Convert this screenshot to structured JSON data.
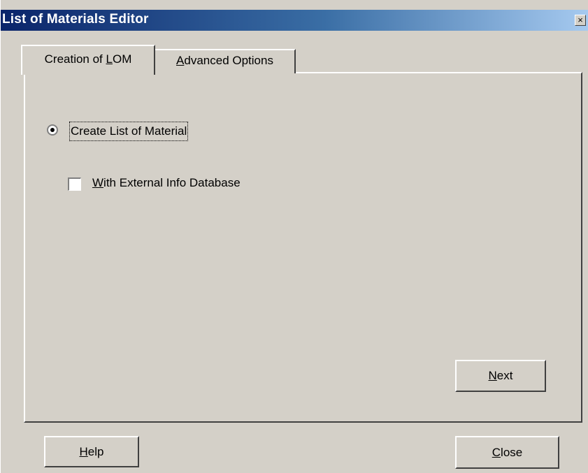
{
  "window": {
    "title": "List of Materials Editor",
    "close_glyph": "×"
  },
  "tabs": [
    {
      "pre": "Creation of ",
      "mnemonic": "L",
      "post": "OM",
      "selected": true
    },
    {
      "pre": "",
      "mnemonic": "A",
      "post": "dvanced Options",
      "selected": false
    }
  ],
  "options": {
    "radio_label": "Create List of Material",
    "radio_selected": true,
    "checkbox_mnemonic": "W",
    "checkbox_label_rest": "ith External Info Database",
    "checkbox_checked": false
  },
  "buttons": {
    "next": {
      "mnemonic": "N",
      "rest": "ext"
    },
    "help": {
      "mnemonic": "H",
      "rest": "elp"
    },
    "close": {
      "mnemonic": "C",
      "rest": "lose"
    }
  },
  "colors": {
    "face": "#d4d0c8",
    "title_start": "#0a246a",
    "title_end": "#a6caf0"
  }
}
